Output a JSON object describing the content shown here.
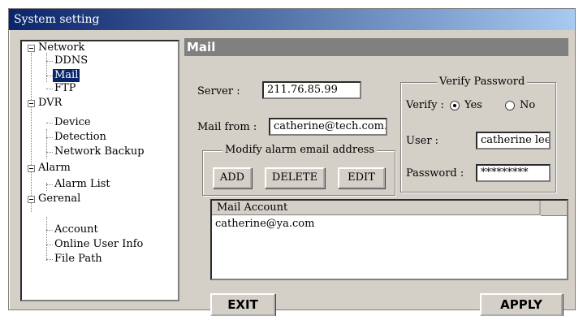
{
  "window": {
    "title": "System setting"
  },
  "tree": {
    "network": "Network",
    "ddns": "DDNS",
    "mail": "Mail",
    "ftp": "FTP",
    "dvr": "DVR",
    "device": "Device",
    "detection": "Detection",
    "network_backup": "Network Backup",
    "alarm": "Alarm",
    "alarm_list": "Alarm List",
    "general": "Gerenal",
    "account": "Account",
    "online_user_info": "Online User Info",
    "file_path": "File Path"
  },
  "mail": {
    "header": "Mail",
    "server_label": "Server :",
    "server_value": "211.76.85.99",
    "from_label": "Mail from :",
    "from_value": "catherine@tech.com.t",
    "modify_group": "Modify alarm email address",
    "add": "ADD",
    "delete": "DELETE",
    "edit": "EDIT",
    "verify_group": "Verify Password",
    "verify_label": "Verify :",
    "yes": "Yes",
    "no": "No",
    "verify_selected": "Yes",
    "user_label": "User :",
    "user_value": "catherine lee",
    "password_label": "Password :",
    "password_value": "*********",
    "list_header": "Mail Account",
    "accounts": [
      "catherine@ya.com"
    ]
  },
  "footer": {
    "exit": "EXIT",
    "apply": "APPLY"
  }
}
